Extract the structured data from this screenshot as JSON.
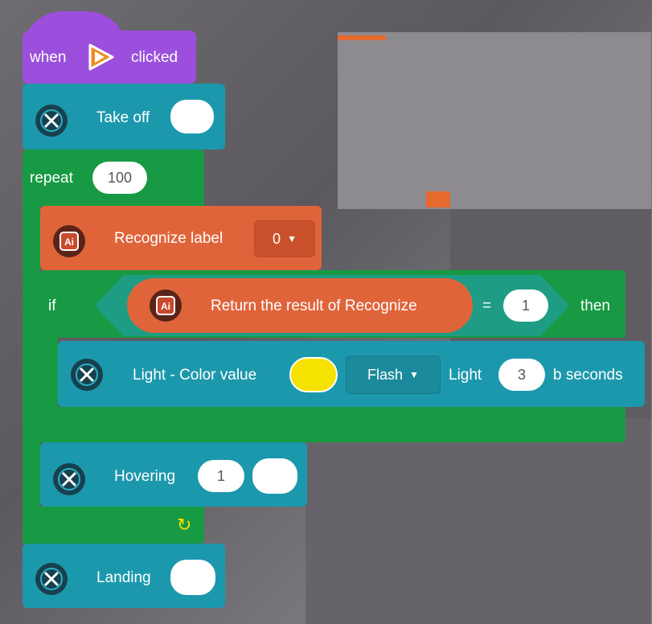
{
  "blocks": {
    "hat": {
      "when": "when",
      "clicked": "clicked",
      "icon": "play-icon"
    },
    "takeoff": {
      "label": "Take off",
      "icon": "drone-icon"
    },
    "repeat": {
      "label": "repeat",
      "count": "100"
    },
    "recognize": {
      "label": "Recognize label",
      "value": "0",
      "icon": "ai-icon"
    },
    "if": {
      "if_label": "if",
      "condition_label": "Return the result of Recognize",
      "operator": "=",
      "value": "1",
      "then_label": "then"
    },
    "light": {
      "label": "Light - Color value",
      "color": "#f6e200",
      "mode": "Flash",
      "light_label": "Light",
      "seconds_value": "3",
      "seconds_label": "b seconds"
    },
    "hovering": {
      "label": "Hovering",
      "value": "1"
    },
    "landing": {
      "label": "Landing"
    },
    "loop_arrow": "↻"
  },
  "colors": {
    "event": "#9b4fdc",
    "drone": "#1c98ad",
    "control": "#179a43",
    "ai": "#e0643a",
    "condition": "#1e9d84"
  }
}
